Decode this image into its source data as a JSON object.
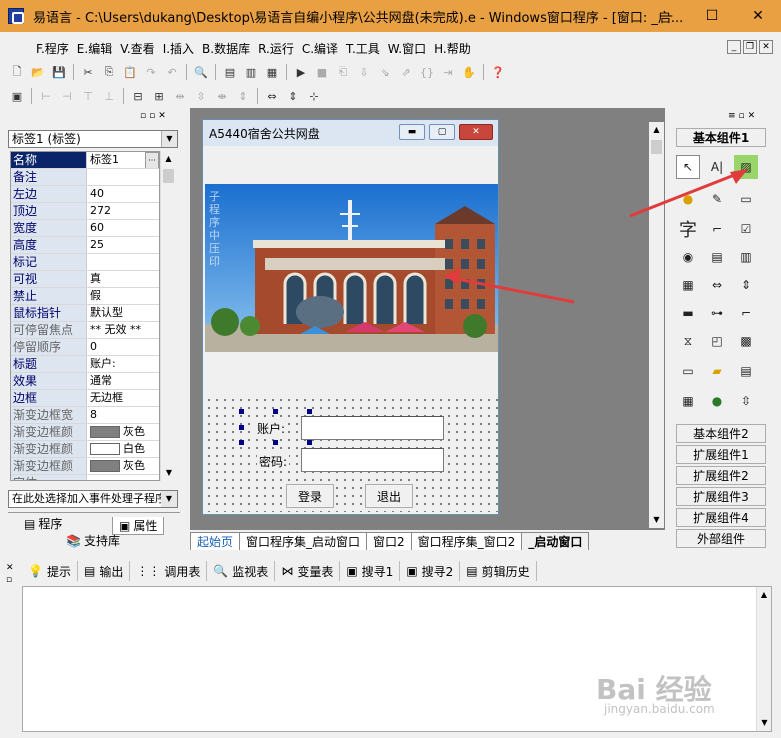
{
  "window": {
    "title": "易语言 - C:\\Users\\dukang\\Desktop\\易语言自编小程序\\公共网盘(未完成).e - Windows窗口程序 - [窗口: _启...",
    "minimize": "—",
    "maximize": "☐",
    "close": "✕"
  },
  "menu": [
    "F.程序",
    "E.编辑",
    "V.查看",
    "I.插入",
    "B.数据库",
    "R.运行",
    "C.编译",
    "T.工具",
    "W.窗口",
    "H.帮助"
  ],
  "left_panel": {
    "selector": "标签1 (标签)",
    "properties": [
      {
        "name": "名称",
        "value": "标签1",
        "style": "sel"
      },
      {
        "name": "备注",
        "value": ""
      },
      {
        "name": "左边",
        "value": "40"
      },
      {
        "name": "顶边",
        "value": "272"
      },
      {
        "name": "宽度",
        "value": "60"
      },
      {
        "name": "高度",
        "value": "25"
      },
      {
        "name": "标记",
        "value": ""
      },
      {
        "name": "可视",
        "value": "真"
      },
      {
        "name": "禁止",
        "value": "假"
      },
      {
        "name": "鼠标指针",
        "value": "默认型"
      },
      {
        "name": "可停留焦点",
        "value": "** 无效 **",
        "style": "gray"
      },
      {
        "name": "停留顺序",
        "value": "0",
        "style": "gray"
      },
      {
        "name": "标题",
        "value": "账户:"
      },
      {
        "name": "效果",
        "value": "通常"
      },
      {
        "name": "边框",
        "value": "无边框"
      },
      {
        "name": "渐变边框宽",
        "value": "8",
        "style": "gray"
      },
      {
        "name": "渐变边框颜",
        "value": "灰色",
        "style": "gray",
        "swatch": "#808080"
      },
      {
        "name": "渐变边框颜",
        "value": "白色",
        "style": "gray",
        "swatch": "#ffffff"
      },
      {
        "name": "渐变边框颜",
        "value": "灰色",
        "style": "gray",
        "swatch": "#808080"
      },
      {
        "name": "字体",
        "value": "",
        "style": "gray"
      }
    ],
    "event_selector": "在此处选择加入事件处理子程序",
    "tab_program": "程序",
    "tab_property": "属性",
    "tab_support": "支持库"
  },
  "form": {
    "title": "A5440宿舍公共网盘",
    "account_label": "账户:",
    "password_label": "密码:",
    "login_button": "登录",
    "exit_button": "退出",
    "photo_side_text": "子程序中压印"
  },
  "editor_tabs": [
    "起始页",
    "窗口程序集_启动窗口",
    "窗口2",
    "窗口程序集_窗口2",
    "_启动窗口"
  ],
  "right_panel": {
    "basic1": "基本组件1",
    "basic2": "基本组件2",
    "ext1": "扩展组件1",
    "ext2": "扩展组件2",
    "ext3": "扩展组件3",
    "ext4": "扩展组件4",
    "external": "外部组件",
    "char_tool": "字"
  },
  "output_tabs": [
    "提示",
    "输出",
    "调用表",
    "监视表",
    "变量表",
    "搜寻1",
    "搜寻2",
    "剪辑历史"
  ],
  "watermark": {
    "main": "Bai 经验",
    "sub": "jingyan.baidu.com"
  },
  "colors": {
    "titlebar": "#e9a043",
    "selection": "#0a246a",
    "design_bg": "#808080",
    "arrow": "#e03c3c"
  }
}
